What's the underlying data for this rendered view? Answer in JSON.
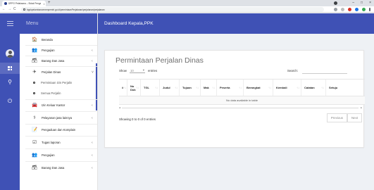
{
  "browser": {
    "tab_title": "DPPO Pelaksana – Sidak Pengawasan Kep",
    "tab_close": "×",
    "new_tab": "+",
    "url": "bppkpelambancemenpemiri.go.id/permintaanPerjalanan/perjalanan/perjalanan",
    "back": "←",
    "forward": "→",
    "reload": "C",
    "minimize": "–",
    "maximize": "□",
    "close": "×"
  },
  "sidebar": {
    "header": "Menu",
    "items": [
      {
        "label": "Beranda",
        "icon": "🏠",
        "arrow": ""
      },
      {
        "label": "Pengujian",
        "icon": "👥",
        "arrow": "‹"
      },
      {
        "label": "Barang Dan Jasa",
        "icon": "🗃",
        "arrow": "‹"
      },
      {
        "label": "Perjalan Dinas",
        "icon": "✈",
        "arrow": "˅"
      },
      {
        "label": "Permintaan Izin Perjalin",
        "arrow": ""
      },
      {
        "label": "Semua Perjalin",
        "arrow": ""
      },
      {
        "label": "Izin Keluar Kantor",
        "icon": "🚘",
        "arrow": "‹"
      },
      {
        "label": "Pelayanan jasa lainnya",
        "icon": "⚕",
        "arrow": "‹"
      },
      {
        "label": "Pengaduan dan Komplain",
        "icon": "📝",
        "arrow": ""
      },
      {
        "label": "Tugas laporan",
        "icon": "☑",
        "arrow": "‹"
      },
      {
        "label": "Pengujian",
        "icon": "👥",
        "arrow": "‹"
      },
      {
        "label": "Barang Dan Jasa",
        "icon": "🗃",
        "arrow": "‹"
      }
    ]
  },
  "rail": {
    "pin_icon": "⚲",
    "power_icon": "⏻"
  },
  "topbar": {
    "title": "Dashboard Kepala,PPK"
  },
  "main": {
    "title": "Permintaan Perjalan Dinas",
    "show_label": "Show",
    "entries_label": "entries",
    "page_length": "10",
    "search_label": "Search:",
    "columns": [
      "#",
      "No Dok",
      "TGL",
      "Judul",
      "Tujuan",
      "Mak",
      "Peserta",
      "Berangkat",
      "Kembali",
      "Catatan",
      "Setuju"
    ],
    "sort_glyph": "↑↓",
    "empty_message": "No data available in table",
    "info": "Showing 0 to 0 of 0 entries",
    "previous": "Previous",
    "next": "Next"
  },
  "colors": {
    "primary": "#3f51b5",
    "rail_active": "#5c6bc0"
  }
}
